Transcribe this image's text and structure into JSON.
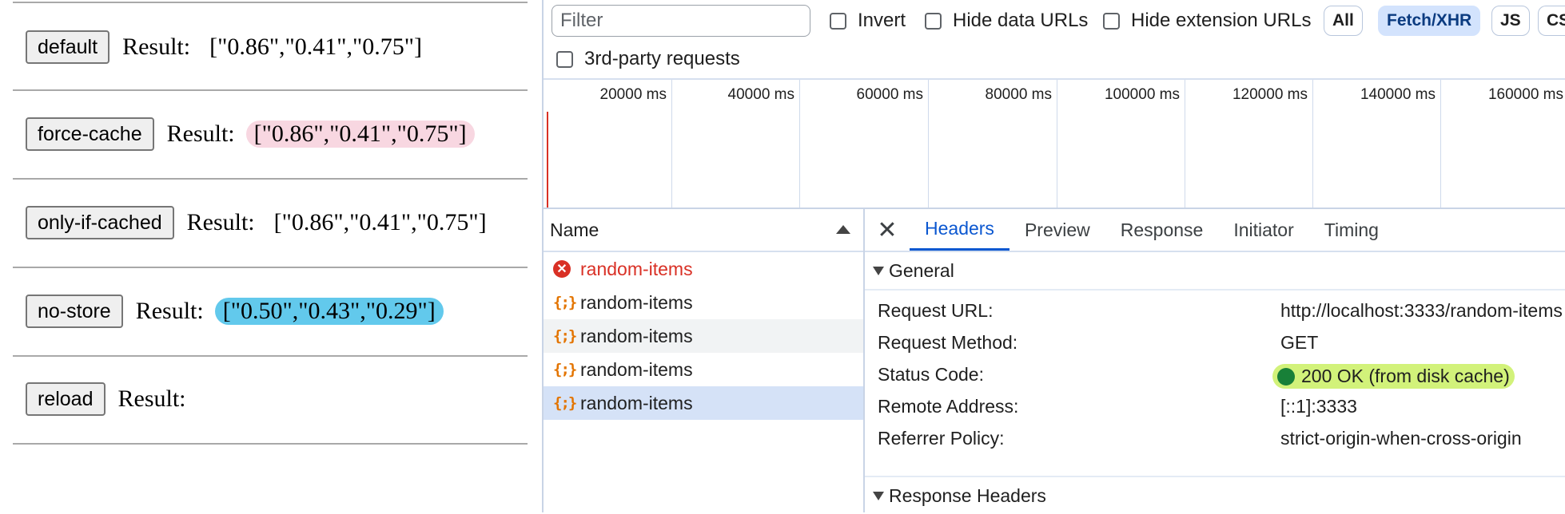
{
  "left": {
    "result_label": "Result:",
    "rows": [
      {
        "button": "default",
        "value": "[\"0.86\",\"0.41\",\"0.75\"]"
      },
      {
        "button": "force-cache",
        "value": "[\"0.86\",\"0.41\",\"0.75\"]"
      },
      {
        "button": "only-if-cached",
        "value": "[\"0.86\",\"0.41\",\"0.75\"]"
      },
      {
        "button": "no-store",
        "value": "[\"0.50\",\"0.43\",\"0.29\"]"
      },
      {
        "button": "reload",
        "value": ""
      }
    ],
    "highlight_colors": {
      "pink": "#f8d7e1",
      "blue": "#62c9ec"
    }
  },
  "devtools": {
    "filter": {
      "placeholder": "Filter"
    },
    "checkboxes": {
      "invert": "Invert",
      "hide_data_urls": "Hide data URLs",
      "hide_extension_urls": "Hide extension URLs",
      "third_party": "3rd-party requests"
    },
    "chips": {
      "all": "All",
      "fetch_xhr": "Fetch/XHR",
      "js": "JS",
      "css": "CS"
    },
    "timeline_ticks": [
      "20000 ms",
      "40000 ms",
      "60000 ms",
      "80000 ms",
      "100000 ms",
      "120000 ms",
      "140000 ms",
      "160000 ms"
    ],
    "name_column": {
      "header": "Name",
      "requests": [
        {
          "name": "random-items",
          "state": "error"
        },
        {
          "name": "random-items",
          "state": "ok"
        },
        {
          "name": "random-items",
          "state": "ok"
        },
        {
          "name": "random-items",
          "state": "ok"
        },
        {
          "name": "random-items",
          "state": "selected"
        }
      ]
    },
    "details": {
      "tabs": [
        "Headers",
        "Preview",
        "Response",
        "Initiator",
        "Timing"
      ],
      "active_tab": "Headers",
      "general_label": "General",
      "general": {
        "request_url_label": "Request URL:",
        "request_url": "http://localhost:3333/random-items",
        "request_method_label": "Request Method:",
        "request_method": "GET",
        "status_code_label": "Status Code:",
        "status_code": "200 OK (from disk cache)",
        "remote_address_label": "Remote Address:",
        "remote_address": "[::1]:3333",
        "referrer_policy_label": "Referrer Policy:",
        "referrer_policy": "strict-origin-when-cross-origin"
      },
      "response_headers_label": "Response Headers"
    },
    "colors": {
      "accent": "#0b57d0",
      "error": "#d93025",
      "status_ok": "#188038",
      "status_highlight": "#d2f27a"
    }
  }
}
